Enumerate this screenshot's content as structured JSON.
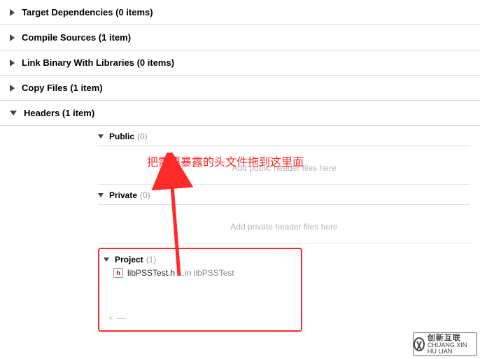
{
  "phases": {
    "target_dependencies": {
      "label": "Target Dependencies (0 items)",
      "expanded": false
    },
    "compile_sources": {
      "label": "Compile Sources (1 item)",
      "expanded": false
    },
    "link_binary": {
      "label": "Link Binary With Libraries (0 items)",
      "expanded": false
    },
    "copy_files": {
      "label": "Copy Files (1 item)",
      "expanded": false
    },
    "headers": {
      "label": "Headers (1 item)",
      "expanded": true
    }
  },
  "headers_section": {
    "public": {
      "label": "Public",
      "count": "(0)",
      "placeholder": "Add public header files here"
    },
    "private": {
      "label": "Private",
      "count": "(0)",
      "placeholder": "Add private header files here"
    },
    "project": {
      "label": "Project",
      "count": "(1)",
      "files": [
        {
          "icon": "h",
          "name": "libPSSTest.h",
          "location": "...in libPSSTest"
        }
      ],
      "add": "+",
      "remove": "—"
    }
  },
  "annotation": {
    "text": "把需要暴露的头文件拖到这里面"
  },
  "watermark": {
    "brand": "创新互联",
    "sub": "CHUANG XIN HU LIAN"
  }
}
